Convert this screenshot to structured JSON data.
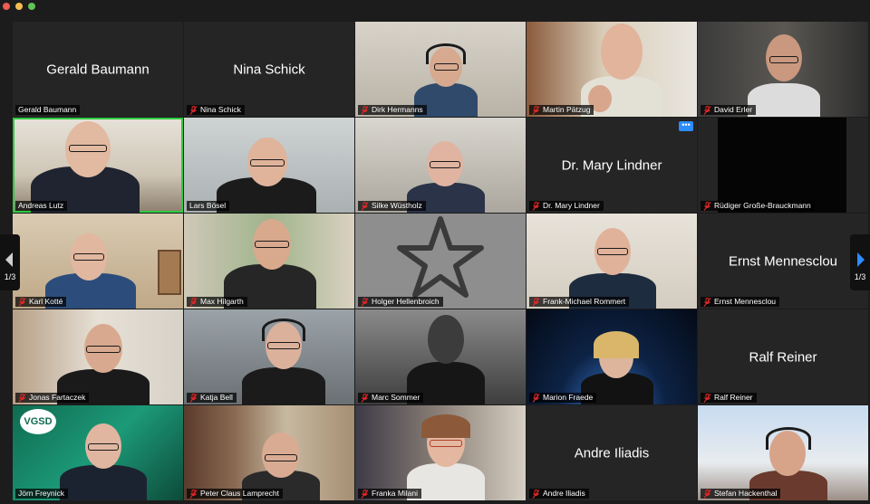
{
  "window": {
    "traffic_lights": [
      "close",
      "minimize",
      "zoom"
    ]
  },
  "navigation": {
    "prev_page": "1/3",
    "next_page": "1/3"
  },
  "tiles": [
    {
      "name": "Gerald Baumann",
      "display": "Gerald Baumann",
      "muted": false,
      "video": false
    },
    {
      "name": "Nina Schick",
      "display": "Nina Schick",
      "muted": true,
      "video": false
    },
    {
      "name": "Dirk Hermanns",
      "muted": true,
      "video": true
    },
    {
      "name": "Martin Pätzug",
      "muted": true,
      "video": true
    },
    {
      "name": "David Erler",
      "muted": true,
      "video": true
    },
    {
      "name": "Andreas Lutz",
      "muted": false,
      "video": true,
      "active_speaker": true
    },
    {
      "name": "Lars Bösel",
      "muted": false,
      "video": true
    },
    {
      "name": "Silke Wüstholz",
      "muted": true,
      "video": true
    },
    {
      "name": "Dr. Mary Lindner",
      "display": "Dr. Mary Lindner",
      "muted": true,
      "video": false
    },
    {
      "name": "Rüdiger Große-Brauckmann",
      "muted": true,
      "video": true
    },
    {
      "name": "Karl Kotté",
      "muted": true,
      "video": true
    },
    {
      "name": "Max Hilgarth",
      "muted": true,
      "video": true
    },
    {
      "name": "Holger Hellenbroich",
      "muted": true,
      "video": false,
      "avatar": "star"
    },
    {
      "name": "Frank-Michael Rommert",
      "muted": true,
      "video": true
    },
    {
      "name": "Ernst Mennesclou",
      "display": "Ernst Mennesclou",
      "muted": true,
      "video": false
    },
    {
      "name": "Jonas Fartaczek",
      "muted": true,
      "video": true
    },
    {
      "name": "Katja Bell",
      "muted": true,
      "video": true
    },
    {
      "name": "Marc Sommer",
      "muted": true,
      "video": true
    },
    {
      "name": "Marion Fraede",
      "muted": true,
      "video": true
    },
    {
      "name": "Ralf Reiner",
      "display": "Ralf Reiner",
      "muted": true,
      "video": false
    },
    {
      "name": "Jörn Freynick",
      "muted": false,
      "video": true,
      "logo_text": "VGSD"
    },
    {
      "name": "Peter Claus Lamprecht",
      "muted": true,
      "video": true
    },
    {
      "name": "Franka Milani",
      "muted": true,
      "video": true
    },
    {
      "name": "Andre Iliadis",
      "display": "Andre Iliadis",
      "muted": true,
      "video": false
    },
    {
      "name": "Stefan Hackenthal",
      "muted": true,
      "video": true
    }
  ],
  "more_button": "•••",
  "colors": {
    "active_speaker": "#2ecc40",
    "accent": "#2d8cff",
    "muted_icon": "#e02828"
  }
}
